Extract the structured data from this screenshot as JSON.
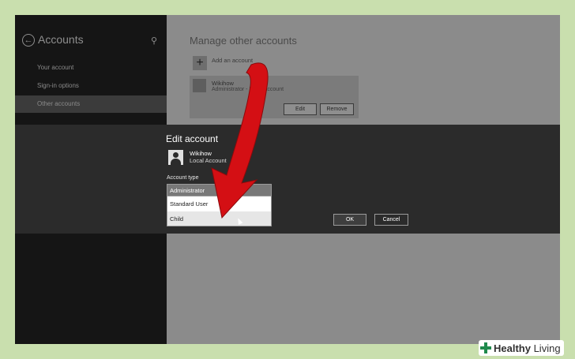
{
  "accounts_pane": {
    "title": "Accounts",
    "nav": [
      "Your account",
      "Sign-in options",
      "Other accounts"
    ],
    "selected_index": 2
  },
  "manage": {
    "title": "Manage other accounts",
    "add_label": "Add an account",
    "account": {
      "name": "Wikihow",
      "sub": "Administrator - Local Account",
      "edit_label": "Edit",
      "remove_label": "Remove"
    }
  },
  "dialog": {
    "title": "Edit account",
    "account_name": "Wikihow",
    "account_sub": "Local Account",
    "type_label": "Account type",
    "selected": "Administrator",
    "options": [
      "Standard User",
      "Child"
    ],
    "ok_label": "OK",
    "cancel_label": "Cancel"
  },
  "watermark": {
    "brand_first": "Healthy",
    "brand_second": " Living"
  },
  "colors": {
    "annotation_arrow": "#d40f14",
    "dialog_bg": "#2b2b2b",
    "backdrop": "#c9dfae"
  }
}
